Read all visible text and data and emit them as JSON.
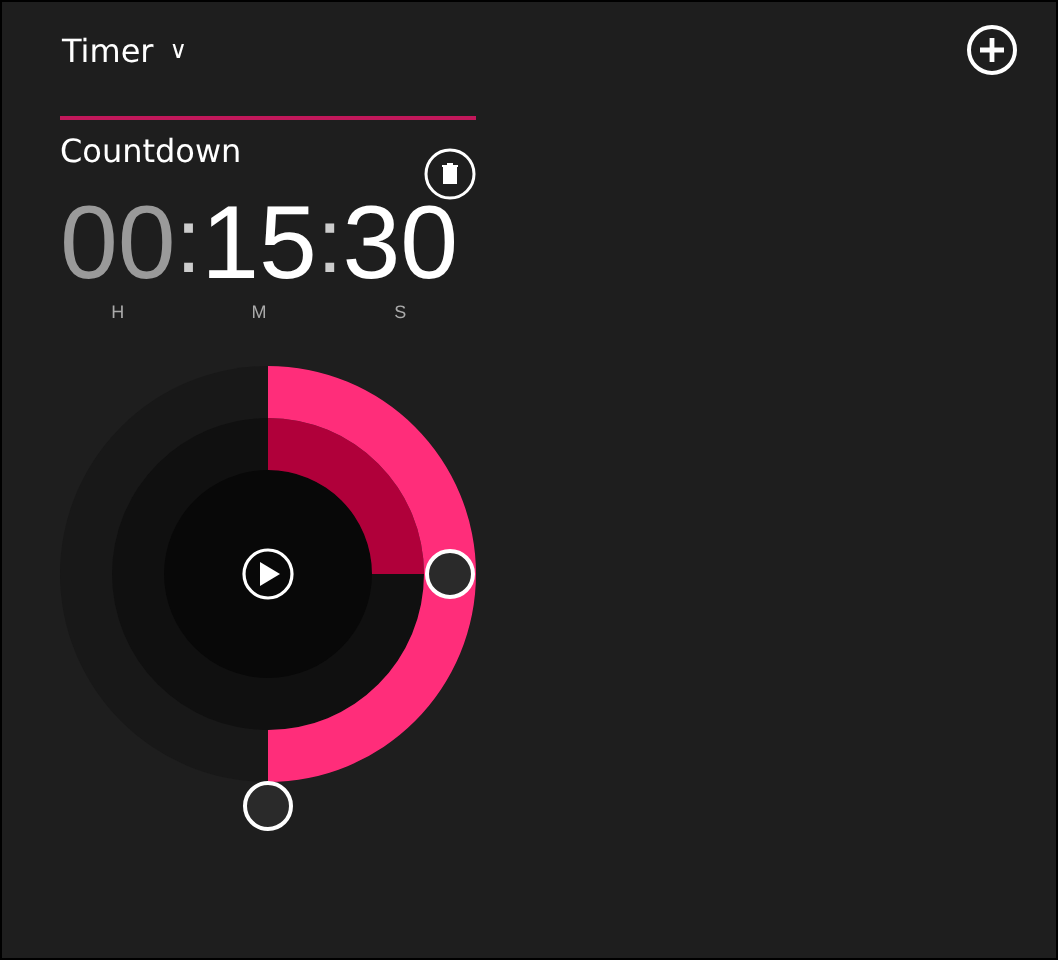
{
  "header": {
    "title": "Timer",
    "dropdown_glyph": "∨"
  },
  "timer": {
    "name": "Countdown",
    "time": [
      {
        "value": "00",
        "unit": "H",
        "dimmed": true
      },
      {
        "value": "15",
        "unit": "M",
        "dimmed": false
      },
      {
        "value": "30",
        "unit": "S",
        "dimmed": false
      }
    ],
    "separators": [
      ":",
      ":"
    ]
  }
}
